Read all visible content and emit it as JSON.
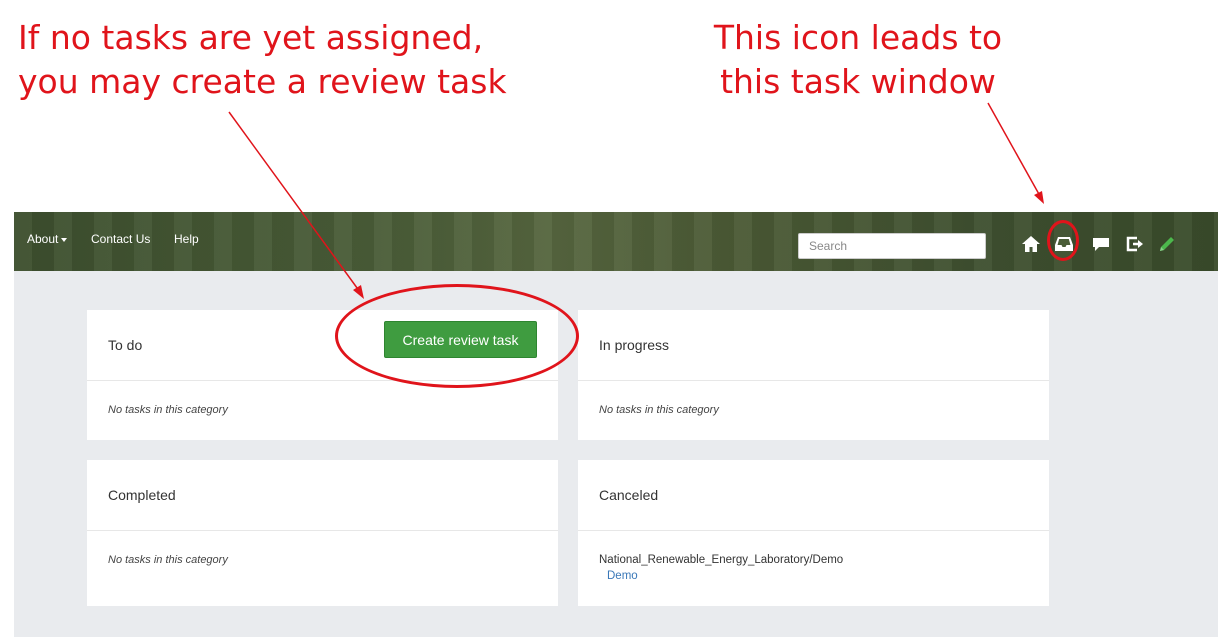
{
  "annotations": {
    "left": {
      "line1": "If no tasks are yet assigned,",
      "line2": "you may create a review task"
    },
    "right": {
      "line1": "This icon leads to",
      "line2": "this task window"
    }
  },
  "navbar": {
    "about": "About",
    "contact": "Contact Us",
    "help": "Help",
    "search_placeholder": "Search",
    "icons": [
      "home-icon",
      "inbox-icon",
      "chat-icon",
      "logout-icon",
      "pencil-icon"
    ]
  },
  "cards": {
    "todo": {
      "title": "To do",
      "button": "Create review task",
      "empty": "No tasks in this category"
    },
    "progress": {
      "title": "In progress",
      "empty": "No tasks in this category"
    },
    "completed": {
      "title": "Completed",
      "empty": "No tasks in this category"
    },
    "canceled": {
      "title": "Canceled",
      "task_path": "National_Renewable_Energy_Laboratory/Demo",
      "task_link": "Demo"
    }
  },
  "colors": {
    "annotation": "#e0141b",
    "button": "#3f9c40",
    "link": "#3a78b8",
    "navbar": "#4a5d38",
    "background": "#e9ebee"
  }
}
